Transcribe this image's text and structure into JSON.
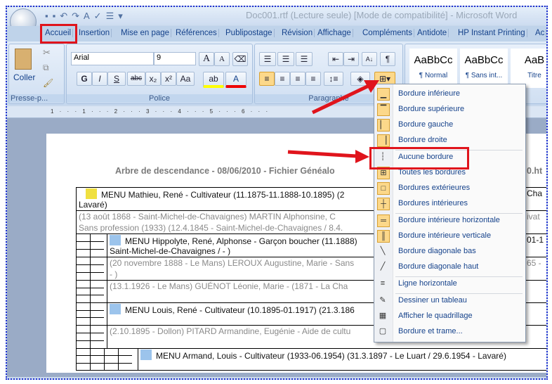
{
  "window": {
    "title": "Doc001.rtf (Lecture seule) [Mode de compatibilité] - Microsoft Word"
  },
  "tabs": [
    "Accueil",
    "Insertion",
    "Mise en page",
    "Références",
    "Publipostage",
    "Révision",
    "Affichage",
    "Compléments",
    "Antidote",
    "HP Instant Printing",
    "Ac"
  ],
  "ribbon": {
    "clipboard": {
      "paste": "Coller",
      "label": "Presse-p..."
    },
    "font": {
      "name": "Arial",
      "size": "9",
      "label": "Police",
      "bold": "G",
      "italic": "I",
      "underline": "S",
      "strike": "abc",
      "sub": "x₂",
      "sup": "x²",
      "case": "Aa",
      "grow": "A",
      "shrink": "A"
    },
    "paragraph": {
      "label": "Paragraphe"
    },
    "styles": [
      {
        "sample": "AaBbCc",
        "name": "¶ Normal"
      },
      {
        "sample": "AaBbCc",
        "name": "¶ Sans int..."
      },
      {
        "sample": "AaB",
        "name": "Titre"
      }
    ]
  },
  "ruler": "1 · · · 1 · · · 2 · · · 3 · · · 4 · · · 5 · · · 6 · · ·",
  "document": {
    "title": "Arbre de descendance - 08/06/2010 - Fichier Généalo",
    "title_right": "0.ht",
    "rows": [
      {
        "lines": [
          "MENU Mathieu, René - Cultivateur (11.1875-11.1888-10.1895)  (2",
          "Lavaré)"
        ],
        "right": "Cha",
        "head": true,
        "marker": "#f0e040"
      },
      {
        "lines": [
          "(13 août 1868 - Saint-Michel-de-Chavaignes)  MARTIN  Alphonsine, C",
          "Sans profession (1933) (12.4.1845  - Saint-Michel-de-Chavaignes  / 8.4."
        ],
        "right": "ivat"
      },
      {
        "lines": [
          "MENU Hippolyte, René, Alphonse - Garçon boucher (11.1888)",
          "Saint-Michel-de-Chavaignes /    - )"
        ],
        "right": "01-1",
        "head": true,
        "marker": "#9cc4ec"
      },
      {
        "lines": [
          "(20 novembre 1888  - Le Mans) LEROUX  Augustine, Marie  - Sans",
          "- )"
        ],
        "right": "65 -"
      },
      {
        "lines": [
          "(13.1.1926  - Le Mans) GUÉNOT  Léonie,  Marie -    (1871  - La Cha"
        ]
      },
      {
        "lines": [
          "MENU Louis, René - Cultivateur (10.1895-01.1917)  (21.3.186"
        ],
        "head": true,
        "marker": "#9cc4ec"
      },
      {
        "lines": [
          "(2.10.1895  - Dollon) PITARD  Armandine,  Eugénie - Aide de cultu"
        ]
      },
      {
        "lines": [
          "MENU Armand, Louis - Cultivateur (1933-06.1954)  (31.3.1897  - Le Luart / 29.6.1954  - Lavaré)"
        ],
        "head": true,
        "marker": "#9cc4ec"
      }
    ]
  },
  "border_menu": {
    "items": [
      {
        "label": "Bordure inférieure",
        "icon": "border-bottom-icon"
      },
      {
        "label": "Bordure supérieure",
        "icon": "border-top-icon"
      },
      {
        "label": "Bordure gauche",
        "icon": "border-left-icon"
      },
      {
        "label": "Bordure droite",
        "icon": "border-right-icon"
      },
      {
        "label": "Aucune bordure",
        "icon": "no-border-icon"
      },
      {
        "label": "Toutes les bordures",
        "icon": "all-borders-icon"
      },
      {
        "label": "Bordures extérieures",
        "icon": "outside-borders-icon"
      },
      {
        "label": "Bordures intérieures",
        "icon": "inside-borders-icon"
      },
      {
        "label": "Bordure intérieure horizontale",
        "icon": "inside-horizontal-border-icon"
      },
      {
        "label": "Bordure intérieure verticale",
        "icon": "inside-vertical-border-icon"
      },
      {
        "label": "Bordure diagonale bas",
        "icon": "diagonal-down-border-icon"
      },
      {
        "label": "Bordure diagonale haut",
        "icon": "diagonal-up-border-icon"
      },
      {
        "label": "Ligne horizontale",
        "icon": "horizontal-line-icon"
      },
      {
        "label": "Dessiner un tableau",
        "icon": "draw-table-icon"
      },
      {
        "label": "Afficher le quadrillage",
        "icon": "gridlines-icon"
      },
      {
        "label": "Bordure et trame...",
        "icon": "borders-shading-icon"
      }
    ]
  },
  "colors": {
    "highlight": "#e0141c",
    "ribbon_text": "#15428b",
    "menu_icon_bg": "#fcd88a"
  }
}
